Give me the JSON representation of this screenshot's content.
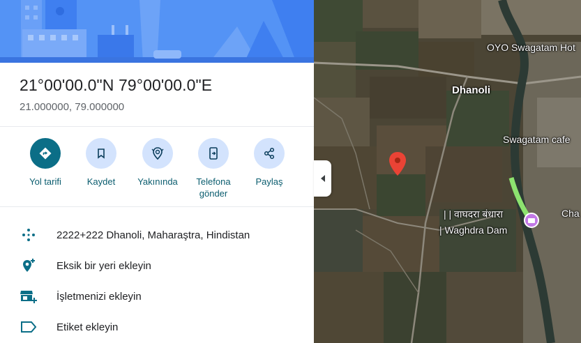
{
  "place": {
    "title": "21°00'00.0\"N 79°00'00.0\"E",
    "decimal_coords": "21.000000, 79.000000"
  },
  "actions": [
    {
      "label": "Yol tarifi",
      "icon": "directions-icon"
    },
    {
      "label": "Kaydet",
      "icon": "bookmark-icon"
    },
    {
      "label": "Yakınında",
      "icon": "nearby-icon"
    },
    {
      "label_line1": "Telefona",
      "label_line2": "gönder",
      "icon": "send-to-phone-icon"
    },
    {
      "label": "Paylaş",
      "icon": "share-icon"
    }
  ],
  "info": {
    "plus_code": "2222+222 Dhanoli, Maharaştra, Hindistan",
    "add_missing_place": "Eksik bir yeri ekleyin",
    "add_business": "İşletmenizi ekleyin",
    "add_label": "Etiket ekleyin"
  },
  "map": {
    "labels": {
      "hotel": "OYO Swagatam Hot",
      "town": "Dhanoli",
      "cafe": "Swagatam cafe",
      "dam_hindi": "| | वाघदरा बंधारा",
      "dam_en": "| Waghdra Dam",
      "edge": "Cha"
    }
  },
  "colors": {
    "accent": "#0b6e87",
    "action_circle": "#d3e3fd",
    "action_label": "#0b5d6f",
    "pin": "#ea4335",
    "hero_bg": "#4d8ef5"
  }
}
